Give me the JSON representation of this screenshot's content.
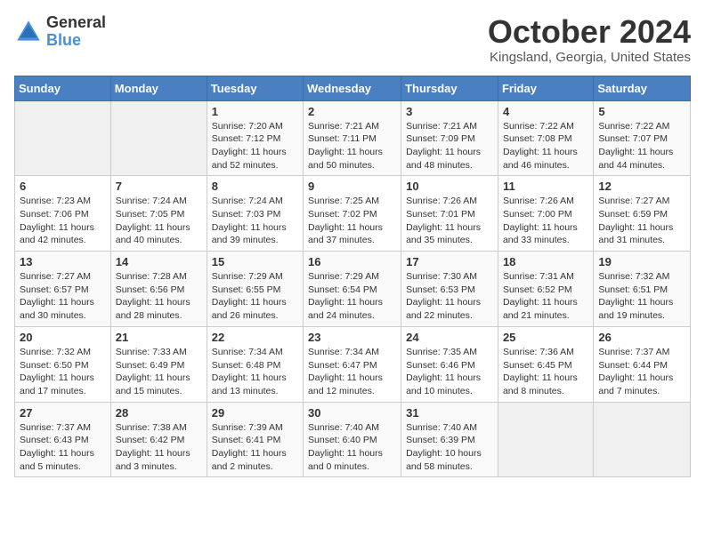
{
  "logo": {
    "general": "General",
    "blue": "Blue"
  },
  "title": "October 2024",
  "location": "Kingsland, Georgia, United States",
  "days_of_week": [
    "Sunday",
    "Monday",
    "Tuesday",
    "Wednesday",
    "Thursday",
    "Friday",
    "Saturday"
  ],
  "weeks": [
    [
      {
        "day": "",
        "sunrise": "",
        "sunset": "",
        "daylight": ""
      },
      {
        "day": "",
        "sunrise": "",
        "sunset": "",
        "daylight": ""
      },
      {
        "day": "1",
        "sunrise": "Sunrise: 7:20 AM",
        "sunset": "Sunset: 7:12 PM",
        "daylight": "Daylight: 11 hours and 52 minutes."
      },
      {
        "day": "2",
        "sunrise": "Sunrise: 7:21 AM",
        "sunset": "Sunset: 7:11 PM",
        "daylight": "Daylight: 11 hours and 50 minutes."
      },
      {
        "day": "3",
        "sunrise": "Sunrise: 7:21 AM",
        "sunset": "Sunset: 7:09 PM",
        "daylight": "Daylight: 11 hours and 48 minutes."
      },
      {
        "day": "4",
        "sunrise": "Sunrise: 7:22 AM",
        "sunset": "Sunset: 7:08 PM",
        "daylight": "Daylight: 11 hours and 46 minutes."
      },
      {
        "day": "5",
        "sunrise": "Sunrise: 7:22 AM",
        "sunset": "Sunset: 7:07 PM",
        "daylight": "Daylight: 11 hours and 44 minutes."
      }
    ],
    [
      {
        "day": "6",
        "sunrise": "Sunrise: 7:23 AM",
        "sunset": "Sunset: 7:06 PM",
        "daylight": "Daylight: 11 hours and 42 minutes."
      },
      {
        "day": "7",
        "sunrise": "Sunrise: 7:24 AM",
        "sunset": "Sunset: 7:05 PM",
        "daylight": "Daylight: 11 hours and 40 minutes."
      },
      {
        "day": "8",
        "sunrise": "Sunrise: 7:24 AM",
        "sunset": "Sunset: 7:03 PM",
        "daylight": "Daylight: 11 hours and 39 minutes."
      },
      {
        "day": "9",
        "sunrise": "Sunrise: 7:25 AM",
        "sunset": "Sunset: 7:02 PM",
        "daylight": "Daylight: 11 hours and 37 minutes."
      },
      {
        "day": "10",
        "sunrise": "Sunrise: 7:26 AM",
        "sunset": "Sunset: 7:01 PM",
        "daylight": "Daylight: 11 hours and 35 minutes."
      },
      {
        "day": "11",
        "sunrise": "Sunrise: 7:26 AM",
        "sunset": "Sunset: 7:00 PM",
        "daylight": "Daylight: 11 hours and 33 minutes."
      },
      {
        "day": "12",
        "sunrise": "Sunrise: 7:27 AM",
        "sunset": "Sunset: 6:59 PM",
        "daylight": "Daylight: 11 hours and 31 minutes."
      }
    ],
    [
      {
        "day": "13",
        "sunrise": "Sunrise: 7:27 AM",
        "sunset": "Sunset: 6:57 PM",
        "daylight": "Daylight: 11 hours and 30 minutes."
      },
      {
        "day": "14",
        "sunrise": "Sunrise: 7:28 AM",
        "sunset": "Sunset: 6:56 PM",
        "daylight": "Daylight: 11 hours and 28 minutes."
      },
      {
        "day": "15",
        "sunrise": "Sunrise: 7:29 AM",
        "sunset": "Sunset: 6:55 PM",
        "daylight": "Daylight: 11 hours and 26 minutes."
      },
      {
        "day": "16",
        "sunrise": "Sunrise: 7:29 AM",
        "sunset": "Sunset: 6:54 PM",
        "daylight": "Daylight: 11 hours and 24 minutes."
      },
      {
        "day": "17",
        "sunrise": "Sunrise: 7:30 AM",
        "sunset": "Sunset: 6:53 PM",
        "daylight": "Daylight: 11 hours and 22 minutes."
      },
      {
        "day": "18",
        "sunrise": "Sunrise: 7:31 AM",
        "sunset": "Sunset: 6:52 PM",
        "daylight": "Daylight: 11 hours and 21 minutes."
      },
      {
        "day": "19",
        "sunrise": "Sunrise: 7:32 AM",
        "sunset": "Sunset: 6:51 PM",
        "daylight": "Daylight: 11 hours and 19 minutes."
      }
    ],
    [
      {
        "day": "20",
        "sunrise": "Sunrise: 7:32 AM",
        "sunset": "Sunset: 6:50 PM",
        "daylight": "Daylight: 11 hours and 17 minutes."
      },
      {
        "day": "21",
        "sunrise": "Sunrise: 7:33 AM",
        "sunset": "Sunset: 6:49 PM",
        "daylight": "Daylight: 11 hours and 15 minutes."
      },
      {
        "day": "22",
        "sunrise": "Sunrise: 7:34 AM",
        "sunset": "Sunset: 6:48 PM",
        "daylight": "Daylight: 11 hours and 13 minutes."
      },
      {
        "day": "23",
        "sunrise": "Sunrise: 7:34 AM",
        "sunset": "Sunset: 6:47 PM",
        "daylight": "Daylight: 11 hours and 12 minutes."
      },
      {
        "day": "24",
        "sunrise": "Sunrise: 7:35 AM",
        "sunset": "Sunset: 6:46 PM",
        "daylight": "Daylight: 11 hours and 10 minutes."
      },
      {
        "day": "25",
        "sunrise": "Sunrise: 7:36 AM",
        "sunset": "Sunset: 6:45 PM",
        "daylight": "Daylight: 11 hours and 8 minutes."
      },
      {
        "day": "26",
        "sunrise": "Sunrise: 7:37 AM",
        "sunset": "Sunset: 6:44 PM",
        "daylight": "Daylight: 11 hours and 7 minutes."
      }
    ],
    [
      {
        "day": "27",
        "sunrise": "Sunrise: 7:37 AM",
        "sunset": "Sunset: 6:43 PM",
        "daylight": "Daylight: 11 hours and 5 minutes."
      },
      {
        "day": "28",
        "sunrise": "Sunrise: 7:38 AM",
        "sunset": "Sunset: 6:42 PM",
        "daylight": "Daylight: 11 hours and 3 minutes."
      },
      {
        "day": "29",
        "sunrise": "Sunrise: 7:39 AM",
        "sunset": "Sunset: 6:41 PM",
        "daylight": "Daylight: 11 hours and 2 minutes."
      },
      {
        "day": "30",
        "sunrise": "Sunrise: 7:40 AM",
        "sunset": "Sunset: 6:40 PM",
        "daylight": "Daylight: 11 hours and 0 minutes."
      },
      {
        "day": "31",
        "sunrise": "Sunrise: 7:40 AM",
        "sunset": "Sunset: 6:39 PM",
        "daylight": "Daylight: 10 hours and 58 minutes."
      },
      {
        "day": "",
        "sunrise": "",
        "sunset": "",
        "daylight": ""
      },
      {
        "day": "",
        "sunrise": "",
        "sunset": "",
        "daylight": ""
      }
    ]
  ]
}
